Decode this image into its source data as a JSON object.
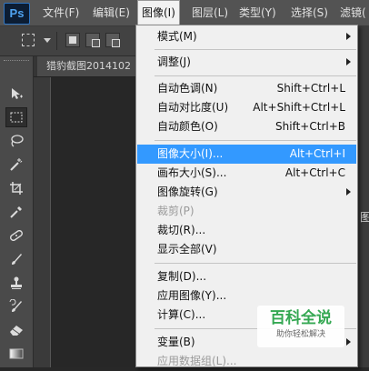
{
  "app": {
    "logo": "Ps"
  },
  "menubar": [
    "文件(F)",
    "编辑(E)",
    "图像(I)",
    "图层(L)",
    "类型(Y)",
    "选择(S)",
    "滤镜("
  ],
  "document_tab": {
    "title": "猎豹截图2014102"
  },
  "right_panel_char": "图",
  "image_menu": {
    "items": [
      {
        "label": "模式(M)",
        "submenu": true
      },
      {
        "label": "调整(J)",
        "submenu": true
      },
      {
        "label": "自动色调(N)",
        "shortcut": "Shift+Ctrl+L"
      },
      {
        "label": "自动对比度(U)",
        "shortcut": "Alt+Shift+Ctrl+L"
      },
      {
        "label": "自动颜色(O)",
        "shortcut": "Shift+Ctrl+B"
      },
      {
        "label": "图像大小(I)...",
        "shortcut": "Alt+Ctrl+I",
        "highlighted": true
      },
      {
        "label": "画布大小(S)...",
        "shortcut": "Alt+Ctrl+C"
      },
      {
        "label": "图像旋转(G)",
        "submenu": true
      },
      {
        "label": "裁剪(P)",
        "disabled": true
      },
      {
        "label": "裁切(R)..."
      },
      {
        "label": "显示全部(V)"
      },
      {
        "label": "复制(D)..."
      },
      {
        "label": "应用图像(Y)..."
      },
      {
        "label": "计算(C)..."
      },
      {
        "label": "变量(B)",
        "submenu": true
      },
      {
        "label": "应用数据组(L)...",
        "disabled": true
      }
    ]
  },
  "watermark": {
    "main": "百科全说",
    "sub": "助你轻松解决"
  },
  "colors": {
    "highlight": "#3399ff",
    "menu_bg": "#f0f0f0",
    "app_bg": "#282828"
  }
}
